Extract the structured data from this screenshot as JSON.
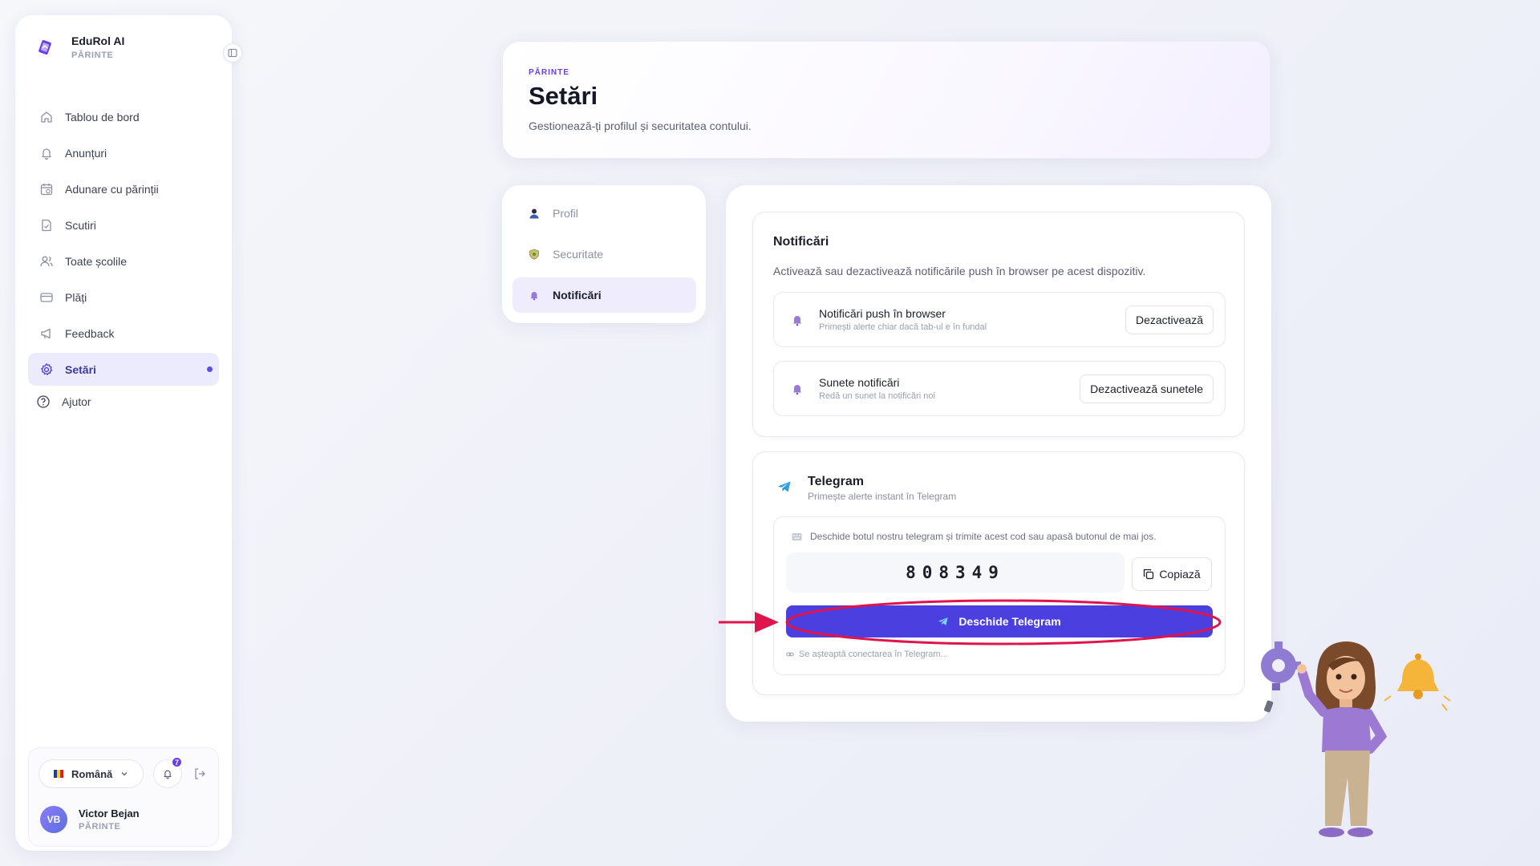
{
  "brand": {
    "name": "EduRol AI",
    "role": "PĂRINTE"
  },
  "nav": [
    {
      "label": "Tablou de bord",
      "icon": "home-icon"
    },
    {
      "label": "Anunțuri",
      "icon": "bell-icon"
    },
    {
      "label": "Adunare cu părinții",
      "icon": "calendar-icon"
    },
    {
      "label": "Scutiri",
      "icon": "document-icon"
    },
    {
      "label": "Toate școlile",
      "icon": "users-icon"
    },
    {
      "label": "Plăți",
      "icon": "credit-card-icon"
    },
    {
      "label": "Feedback",
      "icon": "megaphone-icon"
    },
    {
      "label": "Setări",
      "icon": "gear-icon",
      "active": true
    },
    {
      "label": "Ajutor",
      "icon": "help-circle-icon"
    }
  ],
  "footer": {
    "language": "Română",
    "notification_count": "7",
    "user": {
      "initials": "VB",
      "name": "Victor Bejan",
      "role": "PĂRINTE"
    }
  },
  "header": {
    "eyebrow": "PĂRINTE",
    "title": "Setări",
    "subtitle": "Gestionează-ți profilul și securitatea contului."
  },
  "settings_tabs": [
    {
      "label": "Profil",
      "icon": "user-icon"
    },
    {
      "label": "Securitate",
      "icon": "shield-icon"
    },
    {
      "label": "Notificări",
      "icon": "bell-icon",
      "active": true
    }
  ],
  "notifications": {
    "title": "Notificări",
    "description": "Activează sau dezactivează notificările push în browser pe acest dispozitiv.",
    "push": {
      "title": "Notificări push în browser",
      "subtitle": "Primești alerte chiar dacă tab-ul e în fundal",
      "button": "Dezactivează"
    },
    "sounds": {
      "title": "Sunete notificări",
      "subtitle": "Redă un sunet la notificări noi",
      "button": "Dezactivează sunetele"
    }
  },
  "telegram": {
    "title": "Telegram",
    "subtitle": "Primește alerte instant în Telegram",
    "hint": "Deschide botul nostru telegram și trimite acest cod sau apasă butonul de mai jos.",
    "code": "808349",
    "copy_button": "Copiază",
    "open_button": "Deschide Telegram",
    "waiting": "Se așteaptă conectarea în Telegram..."
  },
  "colors": {
    "accent": "#4b3fdf",
    "accent_light": "#eceafd",
    "eyebrow": "#6a3ee6",
    "annotation": "#e0144c"
  }
}
